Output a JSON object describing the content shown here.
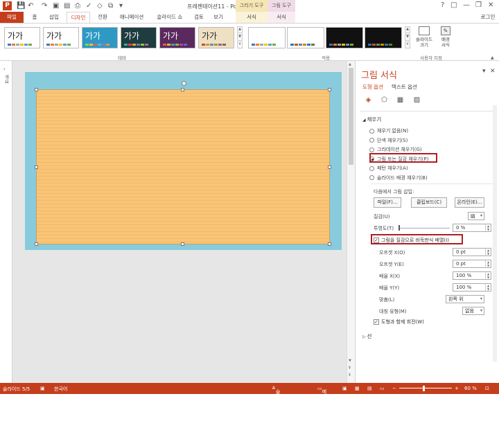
{
  "titlebar": {
    "window_title": "프레젠테이션11 - PowerPoint",
    "ctx_drawing_tools": "그리기 도구",
    "ctx_picture_tools": "그림 도구",
    "help": "?",
    "restore": "□",
    "minimize": "—",
    "maximize": "❐",
    "close": "✕"
  },
  "tabs": [
    {
      "label": "파일"
    },
    {
      "label": "홈"
    },
    {
      "label": "삽입"
    },
    {
      "label": "디자인"
    },
    {
      "label": "전환"
    },
    {
      "label": "애니메이션"
    },
    {
      "label": "슬라이드 쇼"
    },
    {
      "label": "검토"
    },
    {
      "label": "보기"
    },
    {
      "label": "서식"
    },
    {
      "label": "서식"
    }
  ],
  "account": "로그인",
  "ribbon": {
    "themes": [
      {
        "text": "가가",
        "bg": "#ffffff",
        "fg": "#222222",
        "bars": [
          "#4472c4",
          "#ed7d31",
          "#a5a5a5",
          "#ffc000",
          "#5b9bd5",
          "#70ad47"
        ]
      },
      {
        "text": "가가",
        "bg": "#ffffff",
        "fg": "#222222",
        "bars": [
          "#4472c4",
          "#ed7d31",
          "#a5a5a5",
          "#ffc000",
          "#5b9bd5",
          "#70ad47"
        ]
      },
      {
        "text": "가가",
        "bg": "#2e9ac4",
        "fg": "#ffffff",
        "bars": [
          "#8fd14f",
          "#f0c040",
          "#e06060",
          "#60b0e0",
          "#a070c0",
          "#f09040"
        ]
      },
      {
        "text": "가가",
        "bg": "#1f3c40",
        "fg": "#ffffff",
        "bars": [
          "#2bb3a0",
          "#e04060",
          "#f0a030",
          "#6080c0",
          "#a0c040",
          "#c06090"
        ]
      },
      {
        "text": "가가",
        "bg": "#5a2a5e",
        "fg": "#ffffff",
        "bars": [
          "#e06040",
          "#f0b030",
          "#40a0c0",
          "#80c040",
          "#c040a0",
          "#7060c0"
        ]
      },
      {
        "text": "가가",
        "bg": "#efe0c4",
        "fg": "#222222",
        "bars": [
          "#c05030",
          "#e09030",
          "#6090a0",
          "#90a040",
          "#a06080",
          "#707070"
        ]
      }
    ],
    "themes_label": "테마",
    "variants": [
      {
        "bg": "#ffffff",
        "bars": [
          "#4472c4",
          "#ed7d31",
          "#a5a5a5",
          "#ffc000",
          "#5b9bd5",
          "#70ad47"
        ]
      },
      {
        "bg": "#ffffff",
        "bars": [
          "#2e75b6",
          "#c55a11",
          "#7f7f7f",
          "#bf9000",
          "#2e75b6",
          "#538135"
        ]
      },
      {
        "bg": "#111111",
        "bars": [
          "#4472c4",
          "#ed7d31",
          "#a5a5a5",
          "#ffc000",
          "#5b9bd5",
          "#70ad47"
        ]
      },
      {
        "bg": "#111111",
        "bars": [
          "#2e75b6",
          "#c55a11",
          "#7f7f7f",
          "#bf9000",
          "#2e75b6",
          "#538135"
        ]
      }
    ],
    "variants_label": "적용",
    "slide_size": "슬라이드\n크기",
    "format_bg": "배경\n서식",
    "customize_label": "사용자 지정"
  },
  "left_rail": {
    "label": "개요"
  },
  "pane": {
    "title": "그림 서식",
    "tab_shape": "도형 옵션",
    "tab_text": "텍스트 옵션",
    "fill_section": "채우기",
    "fill_options": [
      {
        "label": "채우기 없음(N)",
        "selected": false
      },
      {
        "label": "단색 채우기(S)",
        "selected": false
      },
      {
        "label": "그라데이션 채우기(G)",
        "selected": false
      },
      {
        "label": "그림 또는 질감 채우기(P)",
        "selected": true
      },
      {
        "label": "패턴 채우기(A)",
        "selected": false
      },
      {
        "label": "슬라이드 배경 채우기(B)",
        "selected": false
      }
    ],
    "insert_from": "다음에서 그림 삽입:",
    "btn_file": "파일(F)...",
    "btn_clipboard": "클립보드(C)",
    "btn_online": "온라인(E)...",
    "texture_label": "질감(U)",
    "transparency_label": "투명도(T)",
    "transparency_value": "0 %",
    "tile_label": "그림을 질감으로 바둑판식 배열(I)",
    "tile_checked": true,
    "offset_x_label": "오프셋 X(O)",
    "offset_x_value": "0 pt",
    "offset_y_label": "오프셋 Y(E)",
    "offset_y_value": "0 pt",
    "scale_x_label": "배율 X(X)",
    "scale_x_value": "100 %",
    "scale_y_label": "배율 Y(Y)",
    "scale_y_value": "100 %",
    "align_label": "맞춤(L)",
    "align_value": "왼쪽 위",
    "mirror_label": "대칭 유형(M)",
    "mirror_value": "없음",
    "rotate_label": "도형과 함께 회전(W)",
    "rotate_checked": true,
    "line_section": "선"
  },
  "status": {
    "slide": "슬라이드 5/5",
    "lang": "한국어",
    "notes": "슬라이드 노트",
    "comments": "메모",
    "zoom": "60 %"
  },
  "colors": {
    "accent": "#c43e1c",
    "highlight": "#b01c22",
    "slide_bg": "#87cbdc",
    "texture": "#f9c477"
  }
}
